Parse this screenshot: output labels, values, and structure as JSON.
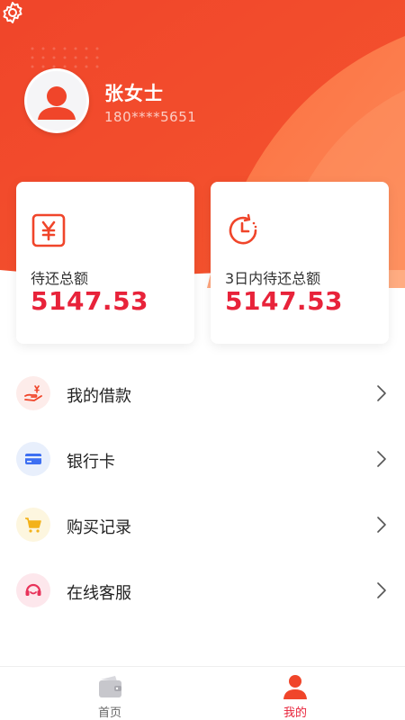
{
  "colors": {
    "primary": "#f0452a",
    "accent_red": "#e8233a",
    "hero_light": "#ff8a5b"
  },
  "profile": {
    "name": "张女士",
    "phone": "180****5651"
  },
  "cards": [
    {
      "label": "待还总额",
      "value": "5147.53",
      "icon": "yuan-icon"
    },
    {
      "label": "3日内待还总额",
      "value": "5147.53",
      "icon": "clock-icon"
    }
  ],
  "menu": [
    {
      "label": "我的借款",
      "icon": "loan-hand-icon"
    },
    {
      "label": "银行卡",
      "icon": "bank-card-icon"
    },
    {
      "label": "购买记录",
      "icon": "cart-icon"
    },
    {
      "label": "在线客服",
      "icon": "headset-icon"
    }
  ],
  "tabs": [
    {
      "label": "首页",
      "icon": "wallet-icon",
      "active": false
    },
    {
      "label": "我的",
      "icon": "person-icon",
      "active": true
    }
  ]
}
